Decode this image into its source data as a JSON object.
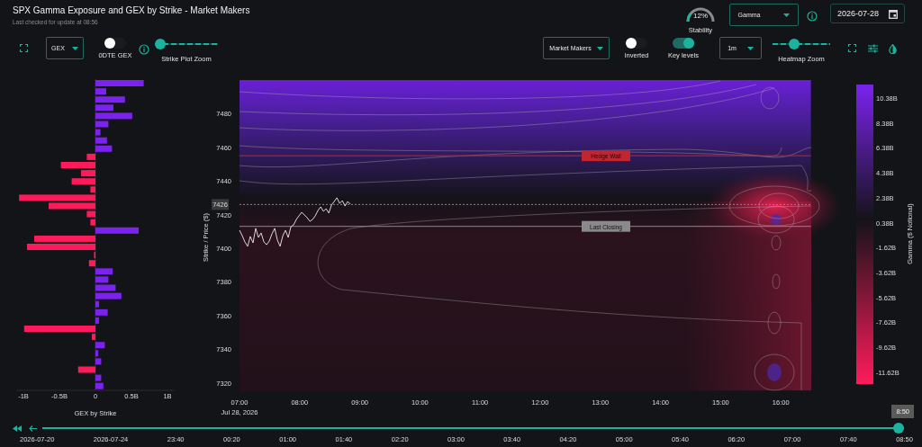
{
  "header": {
    "title": "SPX Gamma Exposure and GEX by Strike - Market Makers",
    "subtitle": "Last checked for update at 08:56",
    "stability": {
      "value": "12%",
      "label": "Stability",
      "level": 0.12
    },
    "metric_select": "Gamma",
    "date": "2026-07-28"
  },
  "controls_left": {
    "gex_select": "GEX",
    "dte_toggle": {
      "label": "0DTE GEX",
      "on": false
    },
    "strike_zoom": {
      "label": "Strike Plot Zoom",
      "level": 0.0
    }
  },
  "controls_right": {
    "participant_select": "Market Makers",
    "inverted": {
      "label": "Inverted",
      "on": false
    },
    "key_levels": {
      "label": "Key levels",
      "on": true
    },
    "interval_select": "1m",
    "heatmap_zoom": {
      "label": "Heatmap Zoom",
      "level": 0.35
    }
  },
  "gex_chart": {
    "chart_data": {
      "type": "bar",
      "orientation": "horizontal",
      "xlabel": "GEX by Strike",
      "xlim": [
        -1.1,
        1.1
      ],
      "series": [
        {
          "color": "#7b22ee",
          "values": [
            0.67,
            0.15,
            0.41,
            0.25,
            0.51,
            0.18,
            0.07,
            0.16,
            0.23,
            null,
            null,
            null,
            null,
            null,
            null,
            null,
            null,
            null,
            0.6,
            null,
            null,
            null,
            null,
            0.24,
            0.18,
            0.28,
            0.36,
            0.05,
            0.17,
            0.05,
            null,
            null,
            0.13,
            0.04,
            0.08,
            null,
            0.08,
            0.11
          ]
        },
        {
          "color": "#ff1b5b",
          "values": [
            null,
            null,
            null,
            null,
            null,
            null,
            null,
            null,
            null,
            -0.12,
            -0.48,
            -0.2,
            -0.33,
            -0.07,
            -1.06,
            -0.65,
            -0.12,
            -0.07,
            null,
            -0.85,
            -0.95,
            -0.02,
            -0.09,
            null,
            null,
            null,
            null,
            null,
            null,
            null,
            -0.99,
            -0.05,
            null,
            null,
            null,
            -0.24,
            null,
            null
          ]
        }
      ],
      "xticks": [
        {
          "value": -1,
          "label": "-1B"
        },
        {
          "value": -0.5,
          "label": "-0.5B"
        },
        {
          "value": 0,
          "label": "0"
        },
        {
          "value": 0.5,
          "label": "0.5B"
        },
        {
          "value": 1,
          "label": "1B"
        }
      ]
    }
  },
  "heatmap": {
    "date_label": "Jul 28, 2026",
    "chart_data": {
      "type": "line",
      "ylabel": "Strike / Price ($)",
      "xlim": [
        7,
        16.5
      ],
      "ylim": [
        7315,
        7500
      ],
      "ref_lines": [
        {
          "axis": "y",
          "value": 7455,
          "label": "Hedge Wall",
          "color": "#c0262f"
        },
        {
          "axis": "y",
          "value": 7426,
          "label": "7426",
          "color": "#888888"
        },
        {
          "axis": "y",
          "value": 7413,
          "label": "Last Closing",
          "color": "#8a8a8a"
        }
      ],
      "x": [
        7,
        7.045,
        7.09,
        7.135,
        7.18,
        7.225,
        7.27,
        7.315,
        7.36,
        7.405,
        7.45,
        7.495,
        7.54,
        7.585,
        7.63,
        7.675,
        7.72,
        7.765,
        7.81,
        7.855,
        7.9,
        7.945,
        7.99,
        8.035,
        8.08,
        8.125,
        8.17,
        8.215,
        8.26,
        8.305,
        8.35,
        8.395,
        8.44,
        8.485,
        8.53,
        8.575,
        8.62,
        8.665,
        8.71,
        8.755,
        8.8,
        8.845
      ],
      "series": [
        {
          "color": "#d8d8d8",
          "values": [
            7410.7,
            7407.5,
            7403.7,
            7401.1,
            7407.0,
            7403.2,
            7411.8,
            7406.4,
            7409.1,
            7403.7,
            7402.1,
            7404.3,
            7408.6,
            7411.8,
            7404.8,
            7401.1,
            7407.5,
            7410.7,
            7406.4,
            7412.8,
            7413.9,
            7417.1,
            7419.3,
            7421.4,
            7419.8,
            7418.2,
            7416.0,
            7417.1,
            7419.3,
            7422.5,
            7424.6,
            7421.9,
            7423.5,
            7420.9,
            7425.7,
            7427.8,
            7430.0,
            7426.7,
            7428.3,
            7425.1,
            7427.8,
            7426.2
          ]
        }
      ],
      "yticks": [
        7480,
        7460,
        7440,
        7420,
        7400,
        7380,
        7360,
        7340,
        7320
      ],
      "xticks": [
        {
          "value": 7,
          "label": "07:00"
        },
        {
          "value": 8,
          "label": "08:00"
        },
        {
          "value": 9,
          "label": "09:00"
        },
        {
          "value": 10,
          "label": "10:00"
        },
        {
          "value": 11,
          "label": "11:00"
        },
        {
          "value": 12,
          "label": "12:00"
        },
        {
          "value": 13,
          "label": "13:00"
        },
        {
          "value": 14,
          "label": "14:00"
        },
        {
          "value": 15,
          "label": "15:00"
        },
        {
          "value": 16,
          "label": "16:00"
        }
      ]
    },
    "colorbar": {
      "label": "Gamma ($ Notional)",
      "ticks": [
        "10.38B",
        "8.38B",
        "6.38B",
        "4.38B",
        "2.38B",
        "0.38B",
        "-1.62B",
        "-3.62B",
        "-5.62B",
        "-7.62B",
        "-9.62B",
        "-11.62B"
      ]
    }
  },
  "timeline": {
    "current": "8:50",
    "level": 1,
    "labels": [
      "2026-07-20",
      "2026-07-24",
      "23:40",
      "00:20",
      "01:00",
      "01:40",
      "02:20",
      "03:00",
      "03:40",
      "04:20",
      "05:00",
      "05:40",
      "06:20",
      "07:00",
      "07:40",
      "08:50"
    ]
  }
}
